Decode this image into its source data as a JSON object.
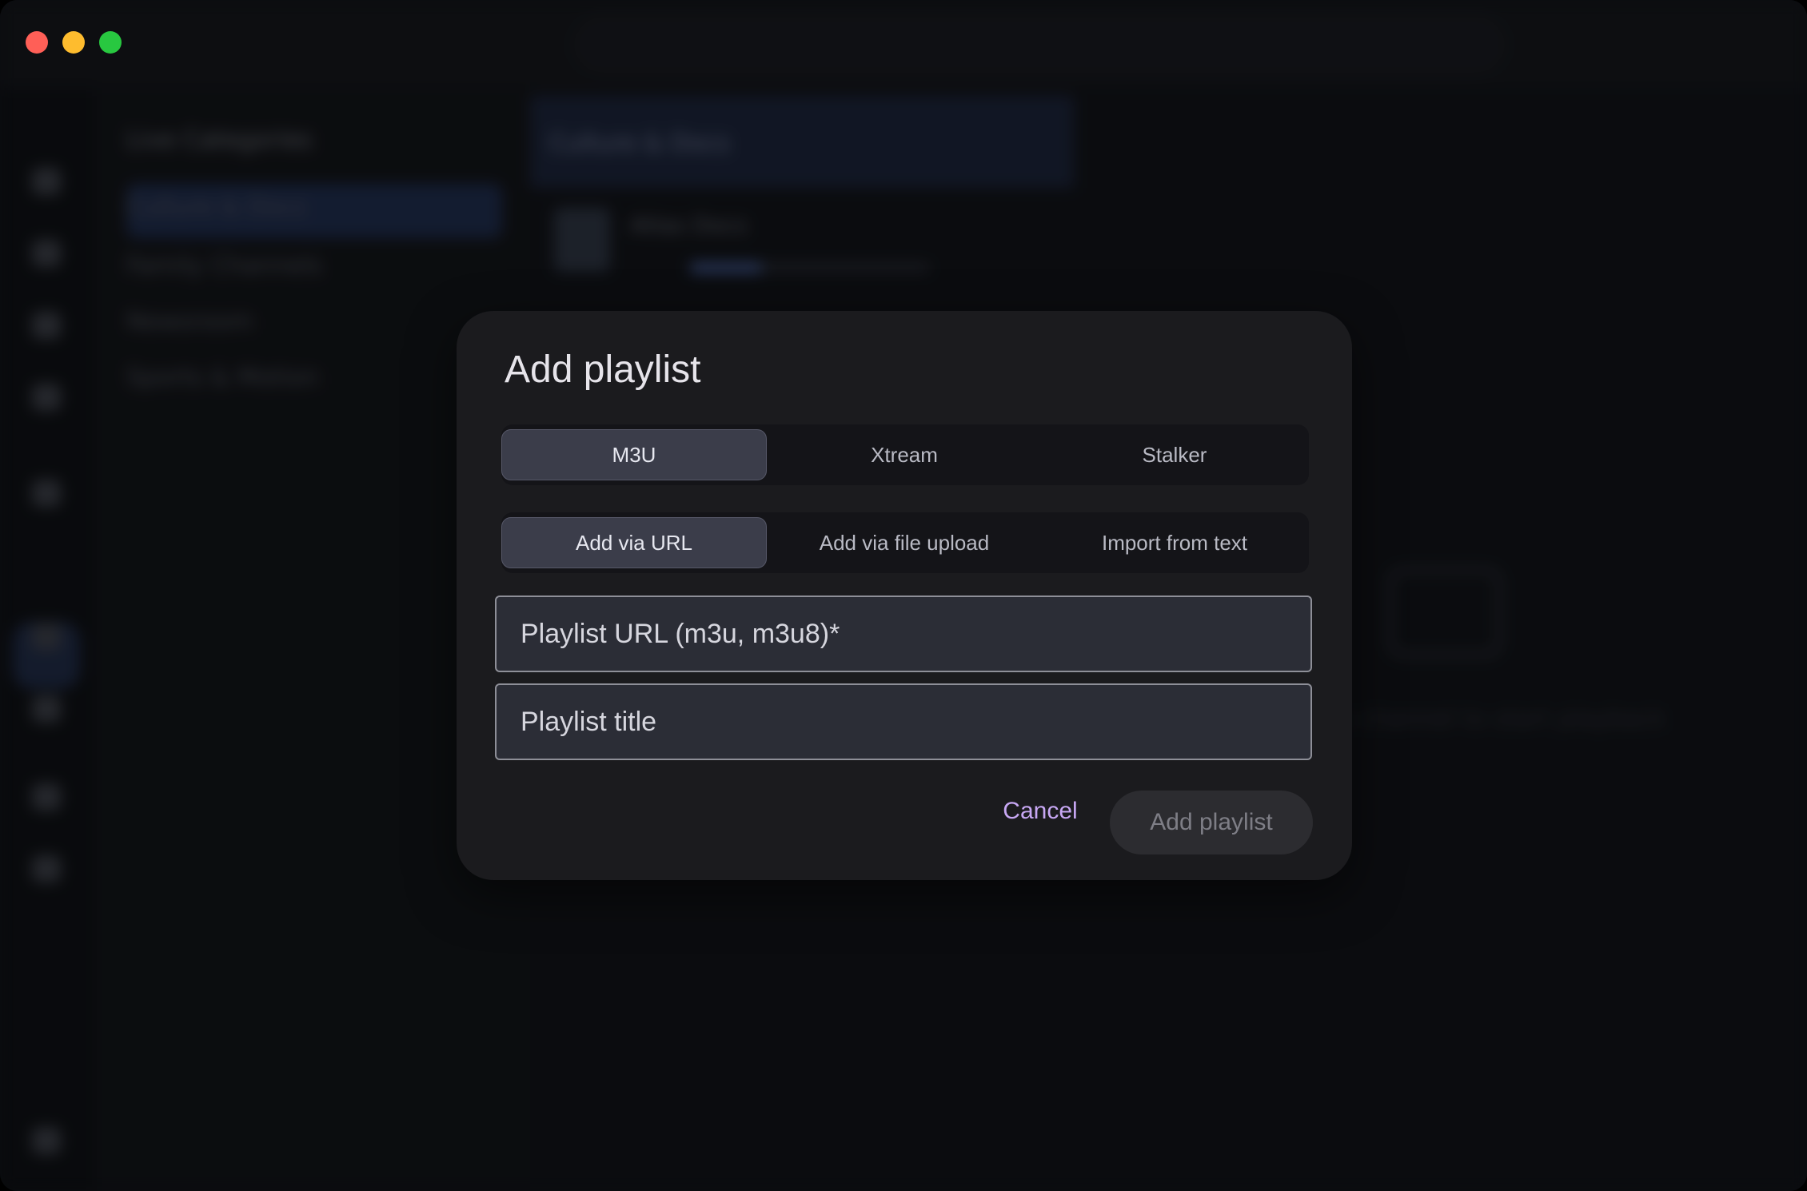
{
  "window": {
    "traffic_colors": {
      "close": "#ff5f57",
      "minimize": "#febc2e",
      "maximize": "#28c840"
    }
  },
  "background": {
    "categories_title": "Live Categories",
    "categories": [
      "Culture & Docs",
      "Family Channels",
      "Newsroom",
      "Sports & Motion"
    ],
    "channel_header": "Culture & Docs",
    "channel_name": "Atlas Docs",
    "player_hint": "a channel to start playback"
  },
  "dialog": {
    "title": "Add playlist",
    "type_tabs": [
      {
        "label": "M3U",
        "active": true
      },
      {
        "label": "Xtream",
        "active": false
      },
      {
        "label": "Stalker",
        "active": false
      }
    ],
    "method_tabs": [
      {
        "label": "Add via URL",
        "active": true
      },
      {
        "label": "Add via file upload",
        "active": false
      },
      {
        "label": "Import from text",
        "active": false
      }
    ],
    "url_field": {
      "placeholder": "Playlist URL (m3u, m3u8)*",
      "value": ""
    },
    "title_field": {
      "placeholder": "Playlist title",
      "value": ""
    },
    "cancel_label": "Cancel",
    "submit_label": "Add playlist"
  }
}
